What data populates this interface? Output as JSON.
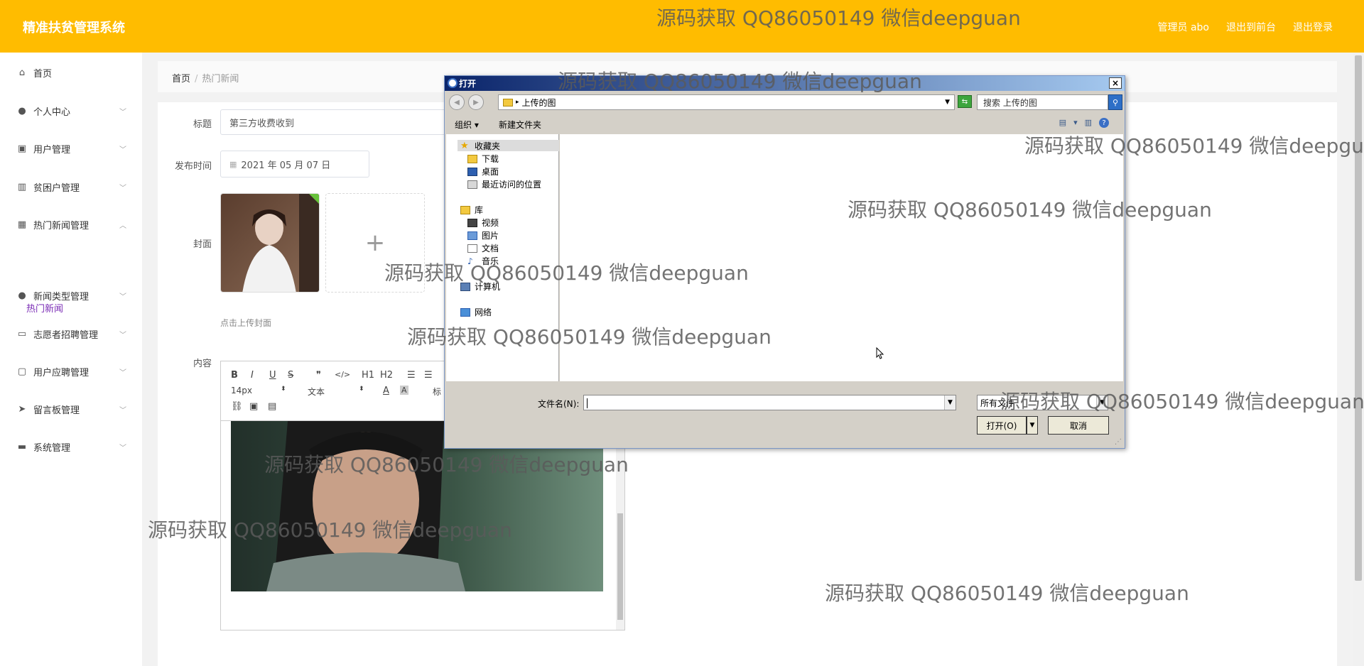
{
  "header": {
    "app_title": "精准扶贫管理系统",
    "admin_label": "管理员 abo",
    "front_link": "退出到前台",
    "logout_link": "退出登录"
  },
  "sidebar": {
    "items": [
      {
        "label": "首页",
        "icon": "home-icon"
      },
      {
        "label": "个人中心",
        "icon": "user-icon"
      },
      {
        "label": "用户管理",
        "icon": "chart-icon"
      },
      {
        "label": "贫困户管理",
        "icon": "bar-chart-icon"
      },
      {
        "label": "热门新闻管理",
        "icon": "grid-icon"
      },
      {
        "label": "新闻类型管理",
        "icon": "user-icon"
      },
      {
        "label": "志愿者招聘管理",
        "icon": "image-icon"
      },
      {
        "label": "用户应聘管理",
        "icon": "comment-icon"
      },
      {
        "label": "留言板管理",
        "icon": "send-icon"
      },
      {
        "label": "系统管理",
        "icon": "briefcase-icon"
      }
    ],
    "submenu_active": "热门新闻"
  },
  "breadcrumb": {
    "home": "首页",
    "sep": "/",
    "current": "热门新闻"
  },
  "form": {
    "title_label": "标题",
    "title_value": "第三方收费收到",
    "time_label": "发布时间",
    "time_value": "2021 年 05 月 07 日",
    "cover_label": "封面",
    "upload_plus": "+",
    "upload_hint": "点击上传封面",
    "content_label": "内容"
  },
  "editor": {
    "font_size": "14px",
    "text_style": "文本",
    "heading_cut": "标",
    "buttons": [
      "B",
      "I",
      "U",
      "S",
      "❞",
      "</>",
      "H1",
      "H2"
    ]
  },
  "dialog": {
    "title": "打开",
    "close": "×",
    "address": "上传的图",
    "search_placeholder": "搜索 上传的图",
    "organize": "组织 ▾",
    "new_folder": "新建文件夹",
    "tree": {
      "favorites": "收藏夹",
      "downloads": "下载",
      "desktop": "桌面",
      "recent": "最近访问的位置",
      "libraries": "库",
      "videos": "视频",
      "pictures": "图片",
      "documents": "文档",
      "music": "音乐",
      "computer": "计算机",
      "network": "网络"
    },
    "filename_label": "文件名(N):",
    "filename_value": "",
    "filter_value": "所有文件",
    "open_btn": "打开(O)",
    "cancel_btn": "取消"
  },
  "watermark": "源码获取 QQ86050149 微信deepguan",
  "colors": {
    "header_bg": "#FFBC00",
    "submenu_active": "#7a2bb5",
    "dialog_title": "#0a246a"
  }
}
